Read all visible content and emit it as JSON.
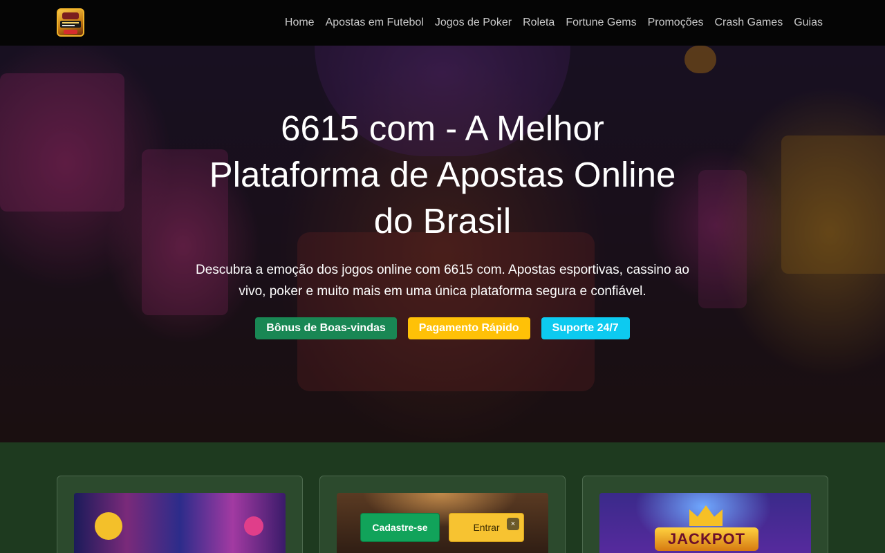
{
  "nav": {
    "logo_name": "site-logo",
    "links": [
      {
        "label": "Home"
      },
      {
        "label": "Apostas em Futebol"
      },
      {
        "label": "Jogos de Poker"
      },
      {
        "label": "Roleta"
      },
      {
        "label": "Fortune Gems"
      },
      {
        "label": "Promoções"
      },
      {
        "label": "Crash Games"
      },
      {
        "label": "Guias"
      }
    ]
  },
  "hero": {
    "title": "6615 com - A Melhor Plataforma de Apostas Online do Brasil",
    "description": "Descubra a emoção dos jogos online com 6615 com. Apostas esportivas, cassino ao vivo, poker e muito mais em uma única plataforma segura e confiável.",
    "badges": [
      {
        "label": "Bônus de Boas-vindas",
        "color": "#198754"
      },
      {
        "label": "Pagamento Rápido",
        "color": "#ffc107"
      },
      {
        "label": "Suporte 24/7",
        "color": "#0dcaf0"
      }
    ]
  },
  "cards": {
    "jackpot_text": "JACKPOT"
  },
  "cta": {
    "register_label": "Cadastre-se",
    "login_label": "Entrar",
    "close_label": "×"
  },
  "colors": {
    "nav_bg": "#050505",
    "section_bg": "#1e3a1f",
    "card_bg": "#2c4a2d",
    "register_green": "#11a35a",
    "login_yellow": "#f7c331"
  }
}
